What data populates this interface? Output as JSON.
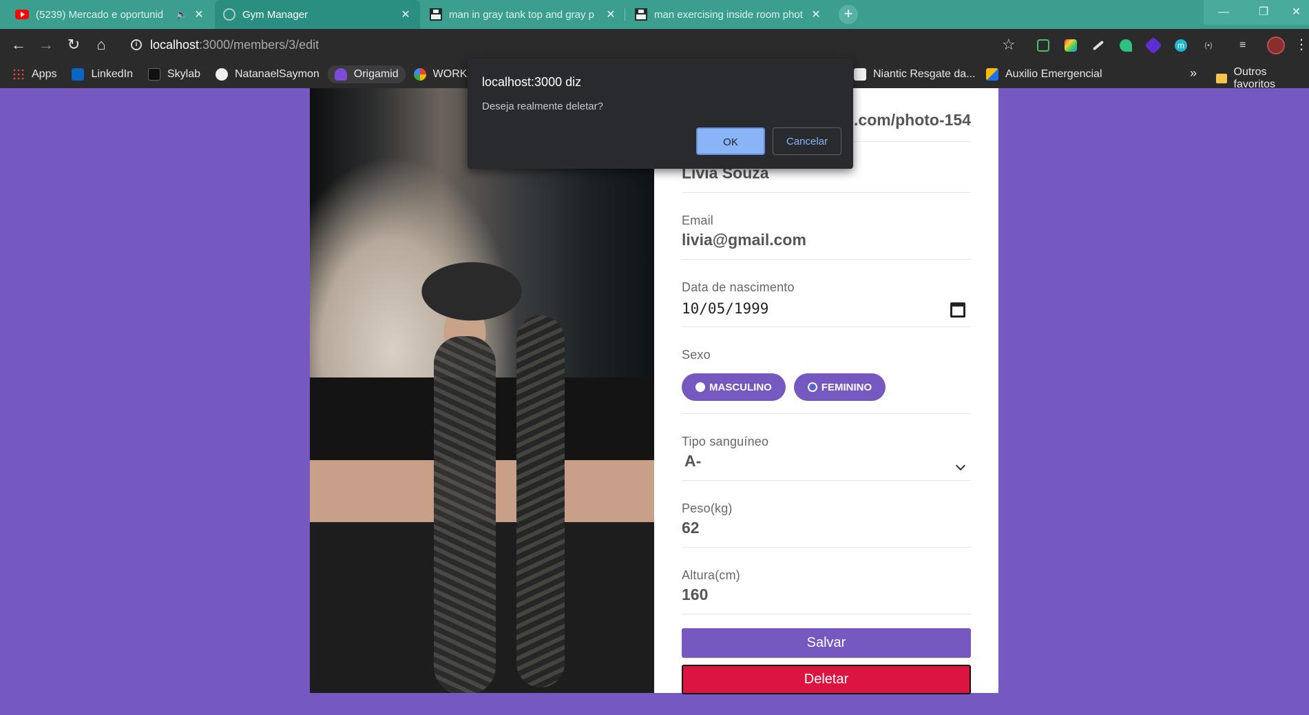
{
  "browser": {
    "tabs": [
      {
        "title": "(5239) Mercado e oportunid",
        "favicon": "youtube-icon",
        "active": false
      },
      {
        "title": "Gym Manager",
        "favicon": "globe-icon",
        "active": true
      },
      {
        "title": "man in gray tank top and gray p",
        "favicon": "unsplash-icon",
        "active": false
      },
      {
        "title": "man exercising inside room phot",
        "favicon": "unsplash-icon",
        "active": false
      }
    ],
    "tab_close": "✕",
    "new_tab": "+",
    "window": {
      "minimize": "—",
      "restore": "❐",
      "close": "✕"
    },
    "url_host": "localhost",
    "url_path": ":3000/members/3/edit",
    "bookmarks": [
      {
        "label": "Apps",
        "icon": "apps-grid-icon"
      },
      {
        "label": "LinkedIn",
        "icon": "linkedin-icon"
      },
      {
        "label": "Skylab",
        "icon": "skylab-icon"
      },
      {
        "label": "NatanaelSaymon",
        "icon": "github-icon"
      },
      {
        "label": "Origamid",
        "icon": "origamid-icon"
      },
      {
        "label": "WORKANA",
        "icon": "workana-icon"
      },
      {
        "label": "Niantic Resgate da...",
        "icon": "niantic-icon"
      },
      {
        "label": "Auxilio Emergencial",
        "icon": "auxilio-icon"
      }
    ],
    "bookmarks_more": "»",
    "other_bookmarks": "Outros favoritos"
  },
  "dialog": {
    "title": "localhost:3000 diz",
    "message": "Deseja realmente deletar?",
    "ok": "OK",
    "cancel": "Cancelar"
  },
  "form": {
    "avatar_url_fragment": "n.com/photo-154",
    "name": "Lívia Souza",
    "email_label": "Email",
    "email": "livia@gmail.com",
    "birth_label": "Data de nascimento",
    "birth": "10/05/1999",
    "gender_label": "Sexo",
    "gender_male": "MASCULINO",
    "gender_female": "FEMININO",
    "gender_selected": "FEMININO",
    "blood_label": "Tipo sanguíneo",
    "blood": "A-",
    "weight_label": "Peso(kg)",
    "weight": "62",
    "height_label": "Altura(cm)",
    "height": "160",
    "save": "Salvar",
    "delete": "Deletar"
  },
  "colors": {
    "accent": "#7658c1",
    "danger": "#dc1441",
    "tabstrip": "#3c9e8f",
    "toolbar": "#2b2b2c",
    "dialog_primary": "#8ab4f8"
  }
}
